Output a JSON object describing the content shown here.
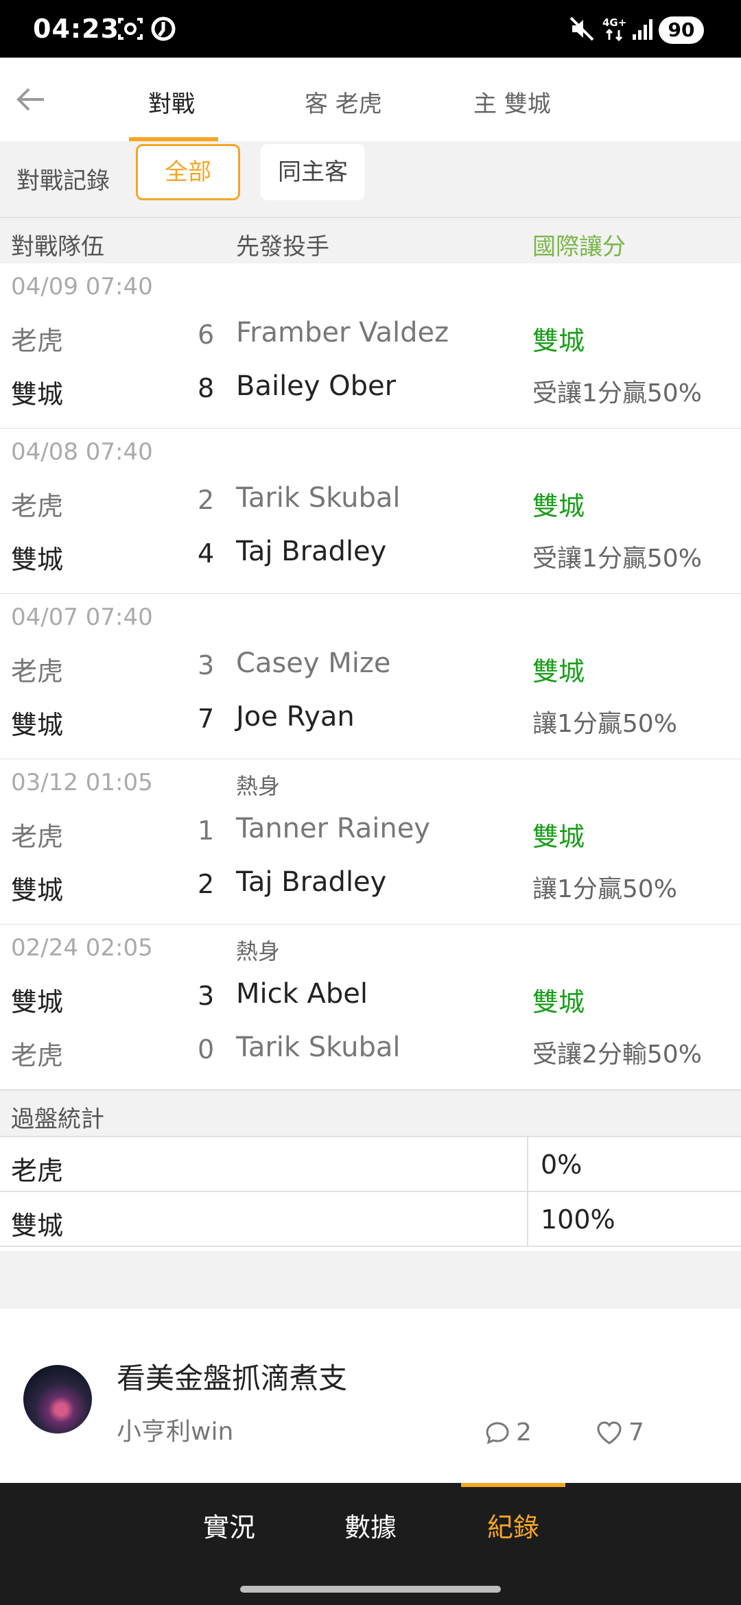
{
  "status_bar": {
    "time": "04:23",
    "network": "4G+",
    "battery": "90"
  },
  "header": {
    "tabs": [
      {
        "label": "對戰"
      },
      {
        "label": "客 老虎"
      },
      {
        "label": "主 雙城"
      }
    ]
  },
  "filter": {
    "label": "對戰記錄",
    "options": [
      {
        "label": "全部"
      },
      {
        "label": "同主客"
      }
    ]
  },
  "columns": {
    "teams": "對戰隊伍",
    "pitchers": "先發投手",
    "handicap": "國際讓分"
  },
  "matches": [
    {
      "date": "04/09 07:40",
      "tag": "",
      "top": {
        "team": "老虎",
        "score": "6",
        "pitcher": "Framber Valdez"
      },
      "bottom": {
        "team": "雙城",
        "score": "8",
        "pitcher": "Bailey Ober"
      },
      "result": "雙城",
      "handicap": "受讓1分贏50%"
    },
    {
      "date": "04/08 07:40",
      "tag": "",
      "top": {
        "team": "老虎",
        "score": "2",
        "pitcher": "Tarik Skubal"
      },
      "bottom": {
        "team": "雙城",
        "score": "4",
        "pitcher": "Taj Bradley"
      },
      "result": "雙城",
      "handicap": "受讓1分贏50%"
    },
    {
      "date": "04/07 07:40",
      "tag": "",
      "top": {
        "team": "老虎",
        "score": "3",
        "pitcher": "Casey Mize"
      },
      "bottom": {
        "team": "雙城",
        "score": "7",
        "pitcher": "Joe Ryan"
      },
      "result": "雙城",
      "handicap": "讓1分贏50%"
    },
    {
      "date": "03/12 01:05",
      "tag": "熱身",
      "top": {
        "team": "老虎",
        "score": "1",
        "pitcher": "Tanner Rainey"
      },
      "bottom": {
        "team": "雙城",
        "score": "2",
        "pitcher": "Taj Bradley"
      },
      "result": "雙城",
      "handicap": "讓1分贏50%"
    },
    {
      "date": "02/24 02:05",
      "tag": "熱身",
      "top": {
        "team": "雙城",
        "score": "3",
        "pitcher": "Mick Abel"
      },
      "bottom": {
        "team": "老虎",
        "score": "0",
        "pitcher": "Tarik Skubal"
      },
      "result": "雙城",
      "handicap": "受讓2分輸50%"
    }
  ],
  "stats": {
    "title": "過盤統計",
    "rows": [
      {
        "team": "老虎",
        "pct": "0%"
      },
      {
        "team": "雙城",
        "pct": "100%"
      }
    ]
  },
  "post": {
    "title": "看美金盤抓滴煮支",
    "author": "小亨利win",
    "comments": "2",
    "likes": "7"
  },
  "bottom_nav": {
    "items": [
      {
        "label": "實況"
      },
      {
        "label": "數據"
      },
      {
        "label": "紀錄"
      }
    ]
  },
  "colors": {
    "accent": "#f5a623",
    "win_green": "#1a9e1a",
    "header_green": "#7ab648"
  }
}
